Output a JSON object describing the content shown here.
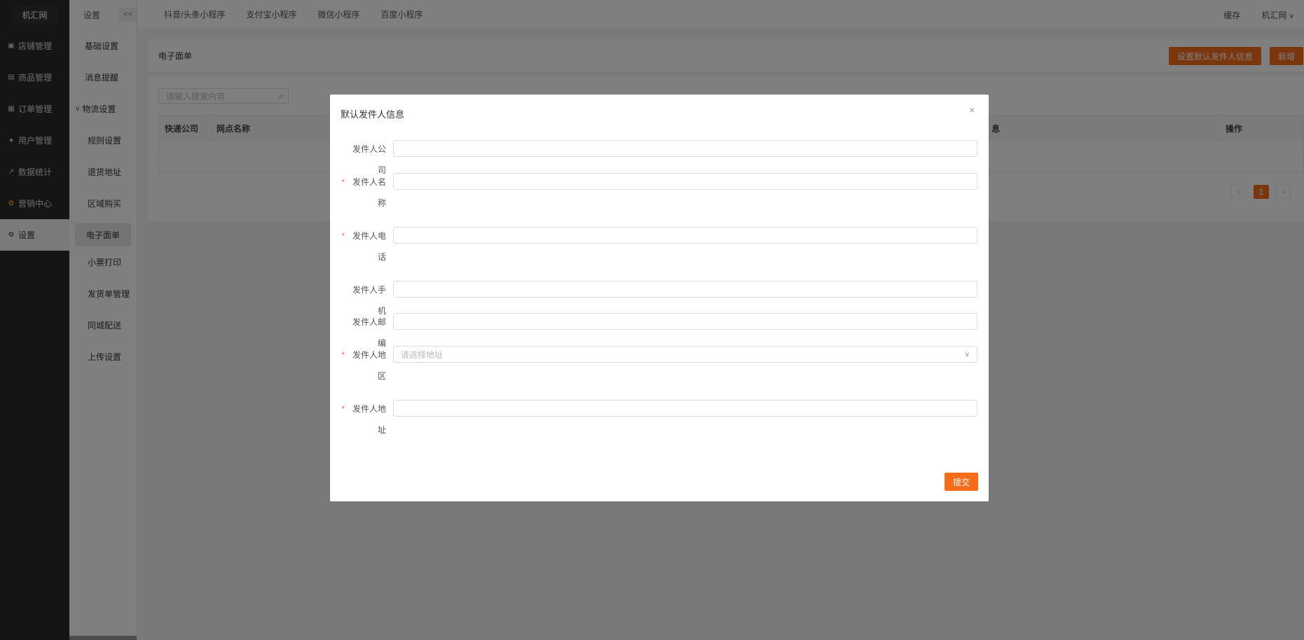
{
  "sidebar": {
    "logo": "机汇网",
    "items": [
      {
        "label": "店铺管理",
        "icon": "store-icon"
      },
      {
        "label": "商品管理",
        "icon": "goods-icon"
      },
      {
        "label": "订单管理",
        "icon": "order-icon"
      },
      {
        "label": "用户管理",
        "icon": "user-icon"
      },
      {
        "label": "数据统计",
        "icon": "chart-icon"
      },
      {
        "label": "营销中心",
        "icon": "marketing-icon"
      },
      {
        "label": "设置",
        "icon": "gear-icon"
      }
    ]
  },
  "subbar": {
    "title": "设置",
    "collapse": "<<",
    "items": [
      "基础设置",
      "消息提醒",
      "物流设置",
      "规则设置",
      "退货地址",
      "区域购买",
      "电子面单",
      "小票打印",
      "发货单管理",
      "同城配送",
      "上传设置"
    ]
  },
  "topbar": {
    "tabs": [
      "抖音/头条小程序",
      "支付宝小程序",
      "微信小程序",
      "百度小程序"
    ],
    "cache": "缓存",
    "user": "机汇网"
  },
  "main": {
    "title": "电子面单",
    "default_sender_btn": "设置默认发件人信息",
    "add_btn": "新增",
    "search_placeholder": "请输入搜索内容",
    "columns": [
      "快递公司",
      "网点名称",
      "息",
      "操作"
    ],
    "page": "1"
  },
  "modal": {
    "title": "默认发件人信息",
    "close": "×",
    "fields": [
      {
        "label": "发件人公司",
        "required": false,
        "value": ""
      },
      {
        "label": "发件人名称",
        "required": true,
        "value": ""
      },
      {
        "label": "发件人电话",
        "required": true,
        "value": ""
      },
      {
        "label": "发件人手机",
        "required": false,
        "value": ""
      },
      {
        "label": "发件人邮编",
        "required": false,
        "value": ""
      },
      {
        "label": "发件人地区",
        "required": true,
        "placeholder": "请选择地址"
      },
      {
        "label": "发件人地址",
        "required": true,
        "value": ""
      }
    ],
    "submit": "提交"
  },
  "colors": {
    "accent": "#f56c1a",
    "sidebar_bg": "#2b2b2b"
  }
}
